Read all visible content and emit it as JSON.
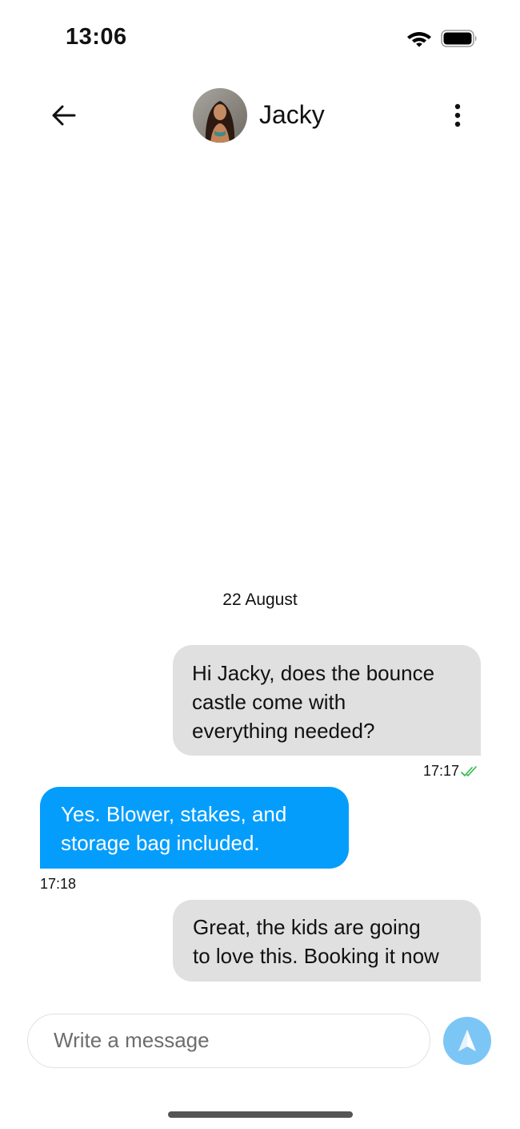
{
  "status_bar": {
    "time": "13:06",
    "wifi_icon": "wifi-icon",
    "battery_icon": "battery-icon"
  },
  "header": {
    "back_icon": "arrow-left-icon",
    "avatar": "contact-avatar",
    "contact_name": "Jacky",
    "more_icon": "more-vertical-icon"
  },
  "conversation": {
    "date_separator": "22 August",
    "messages": [
      {
        "direction": "outgoing",
        "lines": [
          "Hi Jacky, does the bounce",
          "castle come with",
          "everything needed?"
        ],
        "time": "17:17",
        "read_icon": "double-check-icon"
      },
      {
        "direction": "incoming",
        "lines": [
          "Yes. Blower, stakes, and",
          "storage bag included."
        ],
        "time": "17:18"
      },
      {
        "direction": "outgoing",
        "lines": [
          "Great, the kids are going",
          "to love this. Booking it now"
        ]
      }
    ]
  },
  "composer": {
    "placeholder": "Write a message",
    "value": "",
    "send_icon": "send-icon"
  },
  "colors": {
    "incoming_bubble": "#049dfc",
    "outgoing_bubble": "#e0e0e0",
    "send_button": "#7cc6f6",
    "read_check": "#2fb84f"
  }
}
